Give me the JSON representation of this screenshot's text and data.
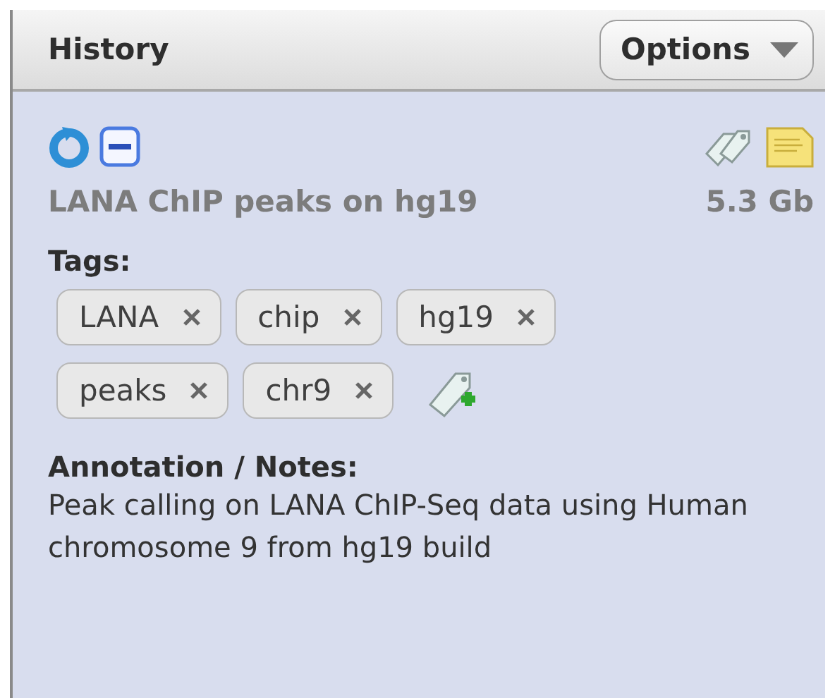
{
  "panel": {
    "title": "History",
    "options_button": "Options"
  },
  "dataset": {
    "name": "LANA ChIP peaks on hg19",
    "size": "5.3 Gb"
  },
  "tags": {
    "label": "Tags:",
    "items": [
      {
        "label": "LANA"
      },
      {
        "label": "chip"
      },
      {
        "label": "hg19"
      },
      {
        "label": "peaks"
      },
      {
        "label": "chr9"
      }
    ]
  },
  "annotation": {
    "label": "Annotation / Notes:",
    "text": "Peak calling on LANA ChIP-Seq data using Human chromosome 9 from hg19 build"
  }
}
